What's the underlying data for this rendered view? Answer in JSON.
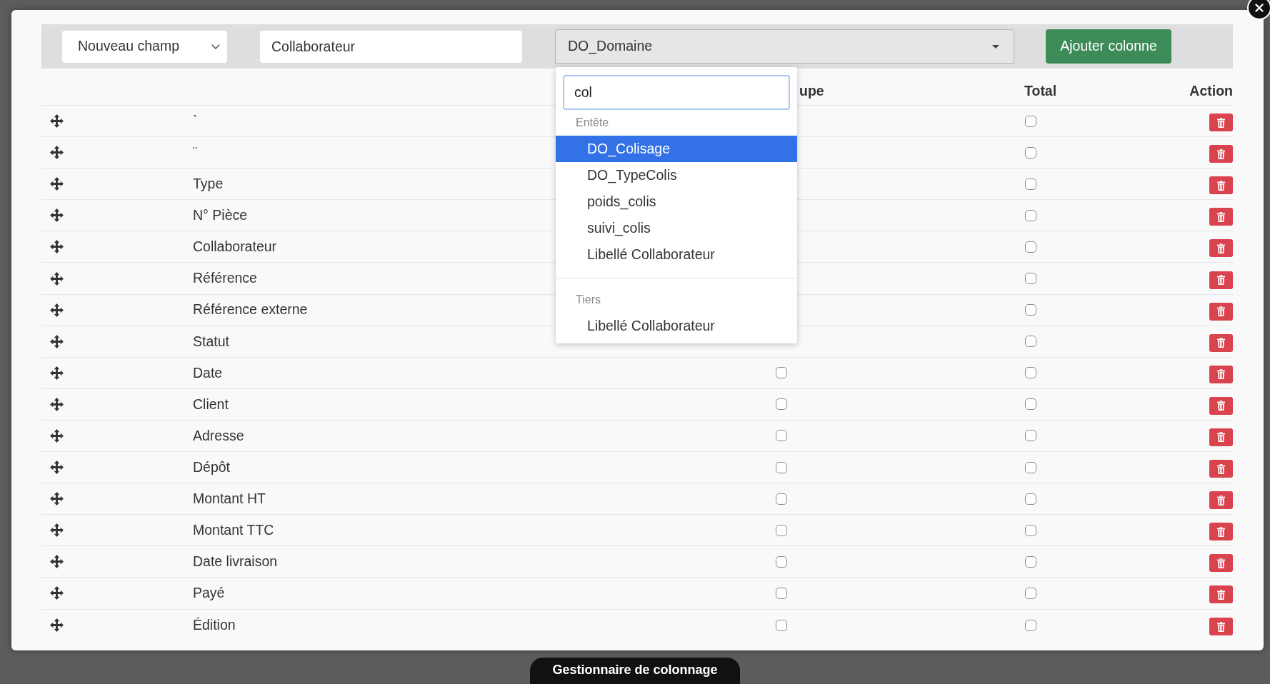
{
  "toolbar": {
    "field_type": {
      "value": "Nouveau champ"
    },
    "label_input": {
      "value": "Collaborateur"
    },
    "source_select": {
      "value": "DO_Domaine",
      "expanded": true
    },
    "add_button": {
      "label": "Ajouter colonne"
    }
  },
  "source_dropdown": {
    "search": {
      "value": "col"
    },
    "groups": [
      {
        "label": "Entête",
        "options": [
          {
            "label": "DO_Colisage",
            "selected": true
          },
          {
            "label": "DO_TypeColis",
            "selected": false
          },
          {
            "label": "poids_colis",
            "selected": false
          },
          {
            "label": "suivi_colis",
            "selected": false
          },
          {
            "label": "Libellé Collaborateur",
            "selected": false
          }
        ]
      },
      {
        "label": "Tiers",
        "options": [
          {
            "label": "Libellé Collaborateur",
            "selected": false
          }
        ]
      }
    ]
  },
  "table": {
    "column_3_header": "upe",
    "total_header": "Total",
    "action_header": "Action",
    "rows": [
      {
        "label": "`",
        "total_checked": false
      },
      {
        "label": "¨",
        "total_checked": false
      },
      {
        "label": "Type",
        "total_checked": false
      },
      {
        "label": "N° Pièce",
        "total_checked": false
      },
      {
        "label": "Collaborateur",
        "total_checked": false
      },
      {
        "label": "Référence",
        "total_checked": false
      },
      {
        "label": "Référence externe",
        "total_checked": false
      },
      {
        "label": "Statut",
        "total_checked": false
      },
      {
        "label": "Date",
        "column_3_checked": false,
        "total_checked": false
      },
      {
        "label": "Client",
        "column_3_checked": false,
        "total_checked": false
      },
      {
        "label": "Adresse",
        "column_3_checked": false,
        "total_checked": false
      },
      {
        "label": "Dépôt",
        "column_3_checked": false,
        "total_checked": false
      },
      {
        "label": "Montant HT",
        "column_3_checked": false,
        "total_checked": false
      },
      {
        "label": "Montant TTC",
        "column_3_checked": false,
        "total_checked": false
      },
      {
        "label": "Date livraison",
        "column_3_checked": false,
        "total_checked": false
      },
      {
        "label": "Payé",
        "column_3_checked": false,
        "total_checked": false
      },
      {
        "label": "Édition",
        "column_3_checked": false,
        "total_checked": false
      }
    ]
  },
  "footer_tab": {
    "label": "Gestionnaire de colonnage"
  }
}
